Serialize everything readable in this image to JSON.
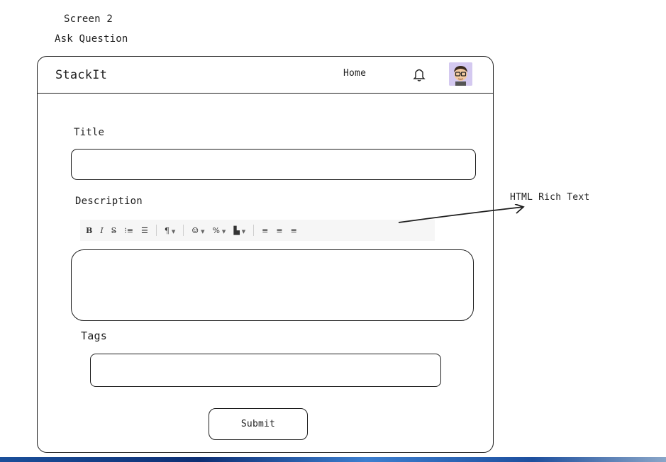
{
  "annotations": {
    "screen_label": "Screen 2",
    "screen_title": "Ask Question",
    "rich_text_note": "HTML Rich Text"
  },
  "header": {
    "brand": "StackIt",
    "home_link": "Home",
    "icons": [
      "bell-icon",
      "avatar"
    ]
  },
  "form": {
    "title_label": "Title",
    "title_value": "",
    "description_label": "Description",
    "description_value": "",
    "tags_label": "Tags",
    "tags_value": "",
    "submit_label": "Submit"
  },
  "toolbar": {
    "bold": "B",
    "italic": "I",
    "strike": "S̶",
    "ordered_list": "⁝≡",
    "bullet_list": "☰",
    "paragraph": "¶",
    "emoji": "☺",
    "link": "%",
    "file": "▙",
    "align_left": "≡",
    "align_center": "≡",
    "align_right": "≡"
  }
}
